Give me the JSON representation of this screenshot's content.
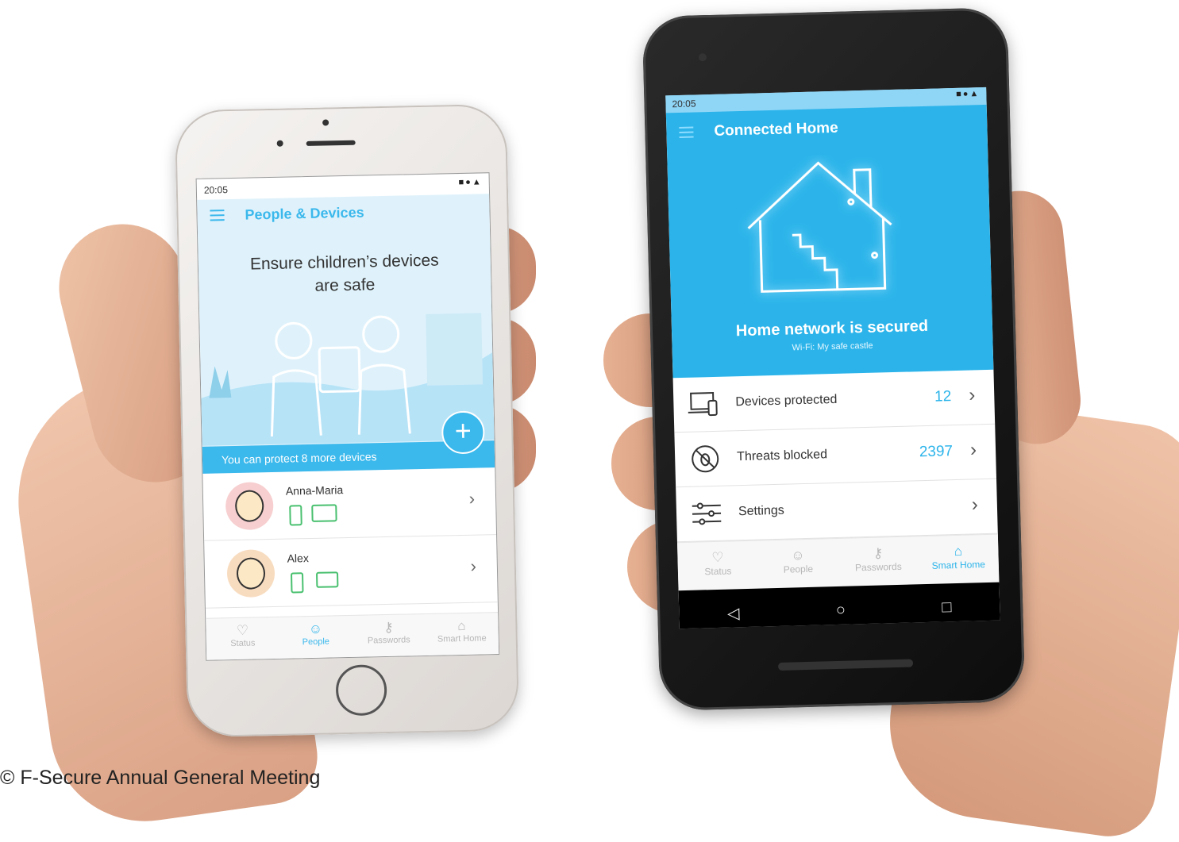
{
  "phone_left": {
    "status_time": "20:05",
    "status_icons": "■●▲",
    "app_title": "People & Devices",
    "headline": "Ensure children’s devices are safe",
    "banner_text": "You can protect 8 more devices",
    "fab_symbol": "+",
    "people": [
      {
        "name": "Anna-Maria",
        "devices": [
          "phone-icon",
          "tablet-icon"
        ]
      },
      {
        "name": "Alex",
        "devices": [
          "phone-icon",
          "tablet-icon"
        ]
      }
    ],
    "chevron": "›",
    "tabs": [
      {
        "label": "Status",
        "icon": "shield-icon",
        "glyph": "♡",
        "active": false
      },
      {
        "label": "People",
        "icon": "people-icon",
        "glyph": "☺",
        "active": true
      },
      {
        "label": "Passwords",
        "icon": "key-icon",
        "glyph": "⚷",
        "active": false
      },
      {
        "label": "Smart Home",
        "icon": "home-icon",
        "glyph": "⌂",
        "active": false
      }
    ]
  },
  "phone_right": {
    "status_time": "20:05",
    "status_icons": "■●▲",
    "app_title": "Connected Home",
    "hero_heading": "Home network is secured",
    "hero_sub": "Wi-Fi: My safe castle",
    "rows": [
      {
        "label": "Devices protected",
        "count": "12",
        "icon": "devices-icon"
      },
      {
        "label": "Threats blocked",
        "count": "2397",
        "icon": "bug-blocked-icon"
      },
      {
        "label": "Settings",
        "count": "",
        "icon": "sliders-icon"
      }
    ],
    "chevron": "›",
    "tabs": [
      {
        "label": "Status",
        "icon": "shield-icon",
        "glyph": "♡",
        "active": false
      },
      {
        "label": "People",
        "icon": "people-icon",
        "glyph": "☺",
        "active": false
      },
      {
        "label": "Passwords",
        "icon": "key-icon",
        "glyph": "⚷",
        "active": false
      },
      {
        "label": "Smart Home",
        "icon": "home-icon",
        "glyph": "⌂",
        "active": true
      }
    ],
    "nav": {
      "back": "◁",
      "home": "○",
      "recents": "□"
    }
  },
  "caption": "© F-Secure Annual General Meeting",
  "colors": {
    "accent": "#3bb8ec",
    "android_accent": "#2cb4ea",
    "device_green": "#49c06f"
  }
}
